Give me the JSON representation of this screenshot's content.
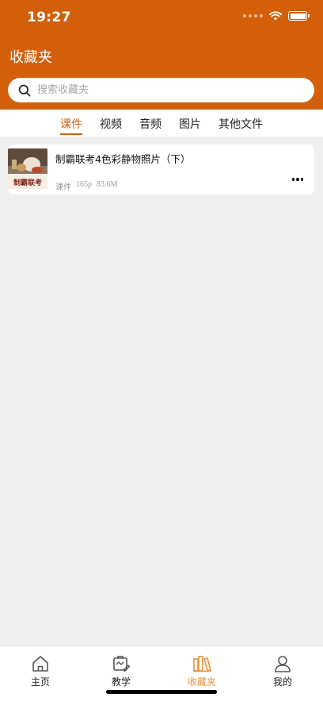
{
  "status_bar": {
    "time": "19:27"
  },
  "header": {
    "title": "收藏夹"
  },
  "search": {
    "placeholder": "搜索收藏夹",
    "value": ""
  },
  "tabs": [
    {
      "label": "课件",
      "active": true
    },
    {
      "label": "视频",
      "active": false
    },
    {
      "label": "音频",
      "active": false
    },
    {
      "label": "图片",
      "active": false
    },
    {
      "label": "其他文件",
      "active": false
    }
  ],
  "items": [
    {
      "title": "制霸联考4色彩静物照片（下）",
      "thumbnail_text": "制霸联考",
      "type": "课件",
      "pages": "165p",
      "size": "83.6M"
    }
  ],
  "bottom_nav": [
    {
      "label": "主页",
      "icon": "home-icon",
      "active": false
    },
    {
      "label": "教学",
      "icon": "teaching-icon",
      "active": false
    },
    {
      "label": "收藏夹",
      "icon": "favorites-icon",
      "active": true
    },
    {
      "label": "我的",
      "icon": "profile-icon",
      "active": false
    }
  ],
  "colors": {
    "accent": "#d35f0a",
    "nav_active": "#e8913d",
    "background": "#efefef"
  }
}
